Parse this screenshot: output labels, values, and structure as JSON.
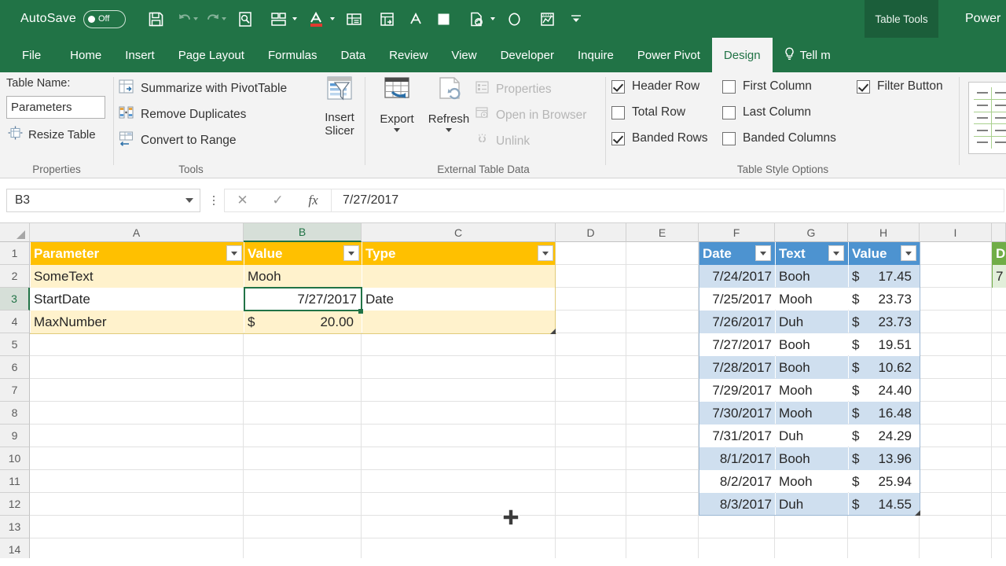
{
  "titlebar": {
    "autosave_label": "AutoSave",
    "autosave_state": "Off",
    "contextual_tab_group": "Table Tools",
    "right_label": "Power",
    "quick_access": [
      {
        "name": "save-icon",
        "label": "Save"
      },
      {
        "name": "undo-icon",
        "label": "Undo"
      },
      {
        "name": "redo-icon",
        "label": "Redo"
      },
      {
        "name": "print-preview-icon",
        "label": "Print Preview"
      },
      {
        "name": "custom-layout-icon",
        "label": "Layout"
      },
      {
        "name": "font-color-icon",
        "label": "Font Color"
      },
      {
        "name": "form-icon",
        "label": "Form"
      },
      {
        "name": "table-export-icon",
        "label": "Export Table"
      },
      {
        "name": "font-icon",
        "label": "Font"
      },
      {
        "name": "fill-color-icon",
        "label": "Fill Color"
      },
      {
        "name": "refresh-doc-icon",
        "label": "Refresh"
      },
      {
        "name": "circle-icon",
        "label": "Shape"
      },
      {
        "name": "chart-icon",
        "label": "Chart"
      },
      {
        "name": "customize-qat-icon",
        "label": "Customize Quick Access Toolbar"
      }
    ]
  },
  "tabs": [
    {
      "label": "File",
      "active": false
    },
    {
      "label": "Home",
      "active": false
    },
    {
      "label": "Insert",
      "active": false
    },
    {
      "label": "Page Layout",
      "active": false
    },
    {
      "label": "Formulas",
      "active": false
    },
    {
      "label": "Data",
      "active": false
    },
    {
      "label": "Review",
      "active": false
    },
    {
      "label": "View",
      "active": false
    },
    {
      "label": "Developer",
      "active": false
    },
    {
      "label": "Inquire",
      "active": false
    },
    {
      "label": "Power Pivot",
      "active": false
    },
    {
      "label": "Design",
      "active": true
    }
  ],
  "tellme": "Tell m",
  "ribbon": {
    "properties": {
      "group_label": "Properties",
      "table_name_label": "Table Name:",
      "table_name_value": "Parameters",
      "resize_table": "Resize Table"
    },
    "tools": {
      "group_label": "Tools",
      "items": [
        "Summarize with PivotTable",
        "Remove Duplicates",
        "Convert to Range"
      ],
      "insert_slicer_line1": "Insert",
      "insert_slicer_line2": "Slicer"
    },
    "external": {
      "group_label": "External Table Data",
      "export": "Export",
      "refresh": "Refresh",
      "properties": "Properties",
      "open_in_browser": "Open in Browser",
      "unlink": "Unlink"
    },
    "style_options": {
      "group_label": "Table Style Options",
      "items": [
        {
          "label": "Header Row",
          "checked": true
        },
        {
          "label": "Total Row",
          "checked": false
        },
        {
          "label": "Banded Rows",
          "checked": true
        },
        {
          "label": "First Column",
          "checked": false
        },
        {
          "label": "Last Column",
          "checked": false
        },
        {
          "label": "Banded Columns",
          "checked": false
        },
        {
          "label": "Filter Button",
          "checked": true
        }
      ]
    }
  },
  "formula_bar": {
    "name_box": "B3",
    "cancel_icon": "✕",
    "confirm_icon": "✓",
    "fx_icon": "fx",
    "value": "7/27/2017"
  },
  "grid": {
    "columns": [
      "A",
      "B",
      "C",
      "D",
      "E",
      "F",
      "G",
      "H",
      "I"
    ],
    "selected_column": "B",
    "rows": [
      "1",
      "2",
      "3",
      "4",
      "5",
      "6",
      "7",
      "8",
      "9",
      "10",
      "11",
      "12",
      "13",
      "14"
    ],
    "selected_row": "3",
    "selected_cell": "B3"
  },
  "parameters_table": {
    "name": "Parameters",
    "headers": [
      "Parameter",
      "Value",
      "Type"
    ],
    "rows": [
      {
        "parameter": "SomeText",
        "value": "Mooh",
        "currency": "",
        "type": ""
      },
      {
        "parameter": "StartDate",
        "value": "7/27/2017",
        "currency": "",
        "type": "Date"
      },
      {
        "parameter": "MaxNumber",
        "value": "20.00",
        "currency": "$",
        "type": ""
      }
    ]
  },
  "data_table": {
    "headers": [
      "Date",
      "Text",
      "Value"
    ],
    "currency_symbol": "$",
    "rows": [
      {
        "date": "7/24/2017",
        "text": "Booh",
        "value": "17.45"
      },
      {
        "date": "7/25/2017",
        "text": "Mooh",
        "value": "23.73"
      },
      {
        "date": "7/26/2017",
        "text": "Duh",
        "value": "23.73"
      },
      {
        "date": "7/27/2017",
        "text": "Booh",
        "value": "19.51"
      },
      {
        "date": "7/28/2017",
        "text": "Booh",
        "value": "10.62"
      },
      {
        "date": "7/29/2017",
        "text": "Mooh",
        "value": "24.40"
      },
      {
        "date": "7/30/2017",
        "text": "Mooh",
        "value": "16.48"
      },
      {
        "date": "7/31/2017",
        "text": "Duh",
        "value": "24.29"
      },
      {
        "date": "8/1/2017",
        "text": "Booh",
        "value": "13.96"
      },
      {
        "date": "8/2/2017",
        "text": "Mooh",
        "value": "25.94"
      },
      {
        "date": "8/3/2017",
        "text": "Duh",
        "value": "14.55"
      }
    ]
  },
  "partial_table": {
    "header": "D",
    "first_value": "7"
  },
  "colors": {
    "excel_green": "#217346",
    "contextual_tab": "#1b5e3a",
    "table_yellow_header": "#ffc000",
    "table_yellow_band": "#fff2cc",
    "table_blue_header": "#4d93d0",
    "table_blue_band": "#cfdfef",
    "table_green_header": "#70ad47",
    "table_green_band": "#e2efda"
  }
}
